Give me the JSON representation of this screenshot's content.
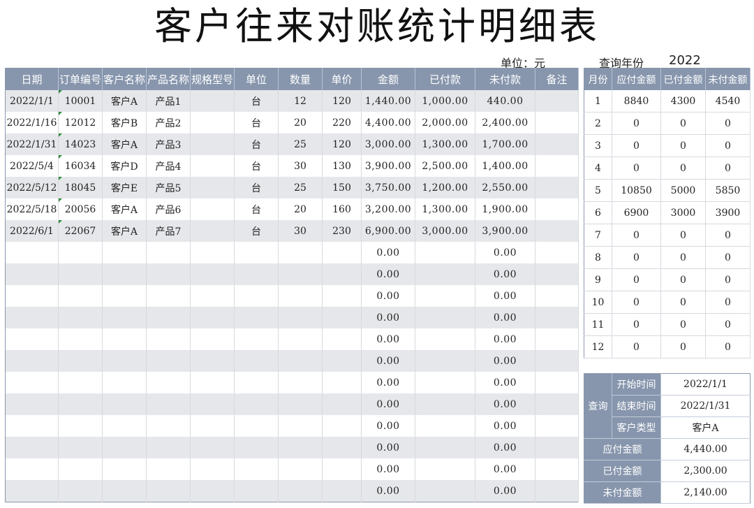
{
  "title": "客户往来对账统计明细表",
  "unit_label": "单位：元",
  "query_year_label": "查询年份",
  "query_year": "2022",
  "ledger": {
    "headers": [
      "日期",
      "订单编号",
      "客户名称",
      "产品名称",
      "规格型号",
      "单位",
      "数量",
      "单价",
      "金额",
      "已付款",
      "未付款",
      "备注"
    ],
    "rows": [
      [
        "2022/1/1",
        "10001",
        "客户A",
        "产品1",
        "",
        "台",
        "12",
        "120",
        "1,440.00",
        "1,000.00",
        "440.00",
        ""
      ],
      [
        "2022/1/16",
        "12012",
        "客户B",
        "产品2",
        "",
        "台",
        "20",
        "220",
        "4,400.00",
        "2,000.00",
        "2,400.00",
        ""
      ],
      [
        "2022/1/31",
        "14023",
        "客户A",
        "产品3",
        "",
        "台",
        "25",
        "120",
        "3,000.00",
        "1,300.00",
        "1,700.00",
        ""
      ],
      [
        "2022/5/4",
        "16034",
        "客户D",
        "产品4",
        "",
        "台",
        "30",
        "130",
        "3,900.00",
        "2,500.00",
        "1,400.00",
        ""
      ],
      [
        "2022/5/12",
        "18045",
        "客户E",
        "产品5",
        "",
        "台",
        "25",
        "150",
        "3,750.00",
        "1,200.00",
        "2,550.00",
        ""
      ],
      [
        "2022/5/18",
        "20056",
        "客户A",
        "产品6",
        "",
        "台",
        "20",
        "160",
        "3,200.00",
        "1,300.00",
        "1,900.00",
        ""
      ],
      [
        "2022/6/1",
        "22067",
        "客户A",
        "产品7",
        "",
        "台",
        "30",
        "230",
        "6,900.00",
        "3,000.00",
        "3,900.00",
        ""
      ],
      [
        "",
        "",
        "",
        "",
        "",
        "",
        "",
        "",
        "0.00",
        "",
        "0.00",
        ""
      ],
      [
        "",
        "",
        "",
        "",
        "",
        "",
        "",
        "",
        "0.00",
        "",
        "0.00",
        ""
      ],
      [
        "",
        "",
        "",
        "",
        "",
        "",
        "",
        "",
        "0.00",
        "",
        "0.00",
        ""
      ],
      [
        "",
        "",
        "",
        "",
        "",
        "",
        "",
        "",
        "0.00",
        "",
        "0.00",
        ""
      ],
      [
        "",
        "",
        "",
        "",
        "",
        "",
        "",
        "",
        "0.00",
        "",
        "0.00",
        ""
      ],
      [
        "",
        "",
        "",
        "",
        "",
        "",
        "",
        "",
        "0.00",
        "",
        "0.00",
        ""
      ],
      [
        "",
        "",
        "",
        "",
        "",
        "",
        "",
        "",
        "0.00",
        "",
        "0.00",
        ""
      ],
      [
        "",
        "",
        "",
        "",
        "",
        "",
        "",
        "",
        "0.00",
        "",
        "0.00",
        ""
      ],
      [
        "",
        "",
        "",
        "",
        "",
        "",
        "",
        "",
        "0.00",
        "",
        "0.00",
        ""
      ],
      [
        "",
        "",
        "",
        "",
        "",
        "",
        "",
        "",
        "0.00",
        "",
        "0.00",
        ""
      ],
      [
        "",
        "",
        "",
        "",
        "",
        "",
        "",
        "",
        "0.00",
        "",
        "0.00",
        ""
      ],
      [
        "",
        "",
        "",
        "",
        "",
        "",
        "",
        "",
        "0.00",
        "",
        "0.00",
        ""
      ]
    ]
  },
  "monthly": {
    "headers": [
      "月份",
      "应付金额",
      "已付金额",
      "未付金额"
    ],
    "rows": [
      [
        "1",
        "8840",
        "4300",
        "4540"
      ],
      [
        "2",
        "0",
        "0",
        "0"
      ],
      [
        "3",
        "0",
        "0",
        "0"
      ],
      [
        "4",
        "0",
        "0",
        "0"
      ],
      [
        "5",
        "10850",
        "5000",
        "5850"
      ],
      [
        "6",
        "6900",
        "3000",
        "3900"
      ],
      [
        "7",
        "0",
        "0",
        "0"
      ],
      [
        "8",
        "0",
        "0",
        "0"
      ],
      [
        "9",
        "0",
        "0",
        "0"
      ],
      [
        "10",
        "0",
        "0",
        "0"
      ],
      [
        "11",
        "0",
        "0",
        "0"
      ],
      [
        "12",
        "0",
        "0",
        "0"
      ]
    ]
  },
  "query": {
    "group_label": "查询",
    "start_label": "开始时间",
    "start_value": "2022/1/1",
    "end_label": "结束时间",
    "end_value": "2022/1/31",
    "customer_label": "客户类型",
    "customer_value": "客户A",
    "payable_label": "应付金额",
    "payable_value": "4,440.00",
    "paid_label": "已付金额",
    "paid_value": "2,300.00",
    "unpaid_label": "未付金额",
    "unpaid_value": "2,140.00"
  },
  "colors": {
    "header_bg": "#8796ad",
    "row_alt_bg": "#e6e7ea",
    "comment_marker": "#2e8b3c"
  }
}
